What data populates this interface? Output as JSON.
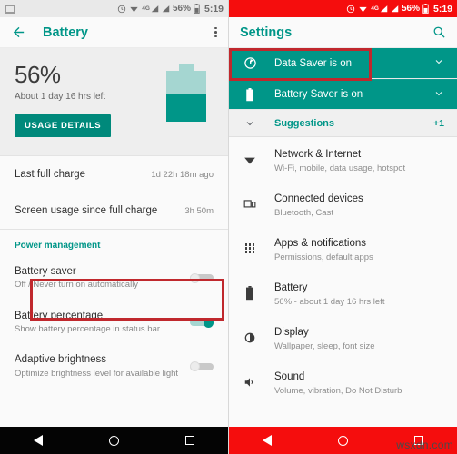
{
  "left_phone": {
    "status_bar": {
      "notification_icon": "screenshot-icon",
      "icons": [
        "dnd-icon",
        "wifi-icon",
        "signal-4g-icon",
        "signal-bars-icon",
        "signal-bars-icon"
      ],
      "network_label": "4G",
      "battery_percent": "56%",
      "time": "5:19"
    },
    "appbar": {
      "back_icon": "back-arrow-icon",
      "title": "Battery",
      "overflow_icon": "overflow-menu-icon"
    },
    "hero": {
      "percent": "56%",
      "estimate": "About 1 day 16 hrs left",
      "usage_button": "USAGE DETAILS",
      "battery_fill_percent": 56
    },
    "info_rows": [
      {
        "title": "Last full charge",
        "value": "1d 22h 18m ago"
      },
      {
        "title": "Screen usage since full charge",
        "value": "3h 50m"
      }
    ],
    "power_management": {
      "header": "Power management",
      "rows": [
        {
          "title": "Battery saver",
          "sub": "Off / Never turn on automatically",
          "toggle": "off",
          "highlighted": true
        },
        {
          "title": "Battery percentage",
          "sub": "Show battery percentage in status bar",
          "toggle": "on",
          "highlighted": false
        },
        {
          "title": "Adaptive brightness",
          "sub": "Optimize brightness level for available light",
          "toggle": "off",
          "highlighted": false
        }
      ]
    },
    "navbar": {
      "back": "back-nav-icon",
      "home": "home-nav-icon",
      "recent": "recent-apps-icon"
    }
  },
  "right_phone": {
    "status_bar": {
      "icons": [
        "dnd-icon",
        "wifi-icon",
        "signal-4g-icon",
        "signal-bars-icon",
        "signal-bars-icon"
      ],
      "network_label": "4G",
      "battery_percent": "56%",
      "time": "5:19"
    },
    "appbar": {
      "title": "Settings",
      "search_icon": "search-icon"
    },
    "banners": [
      {
        "icon": "data-saver-icon",
        "label": "Data Saver is on",
        "chevron": "chevron-down-icon",
        "highlighted": true
      },
      {
        "icon": "battery-saver-icon",
        "label": "Battery Saver is on",
        "chevron": "chevron-down-icon",
        "highlighted": false
      }
    ],
    "suggestions": {
      "chevron": "chevron-down-icon",
      "label": "Suggestions",
      "count": "+1"
    },
    "settings_rows": [
      {
        "icon": "wifi-icon",
        "title": "Network & Internet",
        "sub": "Wi-Fi, mobile, data usage, hotspot"
      },
      {
        "icon": "connected-devices-icon",
        "title": "Connected devices",
        "sub": "Bluetooth, Cast"
      },
      {
        "icon": "apps-grid-icon",
        "title": "Apps & notifications",
        "sub": "Permissions, default apps"
      },
      {
        "icon": "battery-icon",
        "title": "Battery",
        "sub": "56% - about 1 day 16 hrs left"
      },
      {
        "icon": "display-brightness-icon",
        "title": "Display",
        "sub": "Wallpaper, sleep, font size"
      },
      {
        "icon": "sound-volume-icon",
        "title": "Sound",
        "sub": "Volume, vibration, Do Not Disturb"
      }
    ],
    "navbar": {
      "back": "back-nav-icon",
      "home": "home-nav-icon",
      "recent": "recent-apps-icon"
    },
    "watermark": "wsxdn.com"
  },
  "colors": {
    "teal": "#009688",
    "teal_light": "#a5d6d1",
    "red_status": "#f50d0d",
    "annotation_red": "#c0282d"
  }
}
